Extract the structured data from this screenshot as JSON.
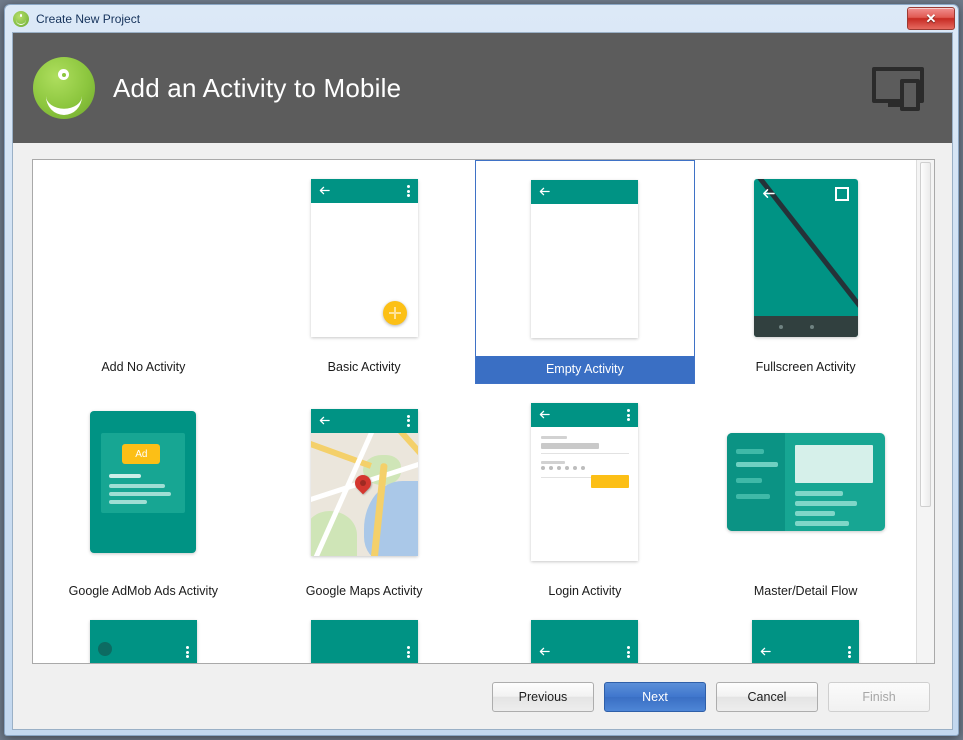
{
  "window": {
    "title": "Create New Project",
    "title_icon": "android-studio-icon",
    "close_label": "✕"
  },
  "header": {
    "title": "Add an Activity to Mobile",
    "logo_icon": "android-studio-logo",
    "formfactor_icon": "mobile-device-icon",
    "background_color": "#5c5c5c"
  },
  "colors": {
    "teal": "#009384",
    "amber": "#fcbf16",
    "selection_blue": "#3a6fc4",
    "map_pin_red": "#d4372f"
  },
  "templates": [
    {
      "label": "Add No Activity",
      "thumb": "none",
      "selected": false
    },
    {
      "label": "Basic Activity",
      "thumb": "basic",
      "selected": false
    },
    {
      "label": "Empty Activity",
      "thumb": "empty",
      "selected": true
    },
    {
      "label": "Fullscreen Activity",
      "thumb": "fullscreen",
      "selected": false
    },
    {
      "label": "Google AdMob Ads Activity",
      "thumb": "admob",
      "selected": false
    },
    {
      "label": "Google Maps Activity",
      "thumb": "maps",
      "selected": false
    },
    {
      "label": "Login Activity",
      "thumb": "login",
      "selected": false
    },
    {
      "label": "Master/Detail Flow",
      "thumb": "masterdetail",
      "selected": false
    }
  ],
  "admob": {
    "badge_label": "Ad"
  },
  "scrollbar": {
    "orientation": "vertical",
    "thumb_fraction": 0.69
  },
  "footer": {
    "previous_label": "Previous",
    "next_label": "Next",
    "cancel_label": "Cancel",
    "finish_label": "Finish"
  }
}
